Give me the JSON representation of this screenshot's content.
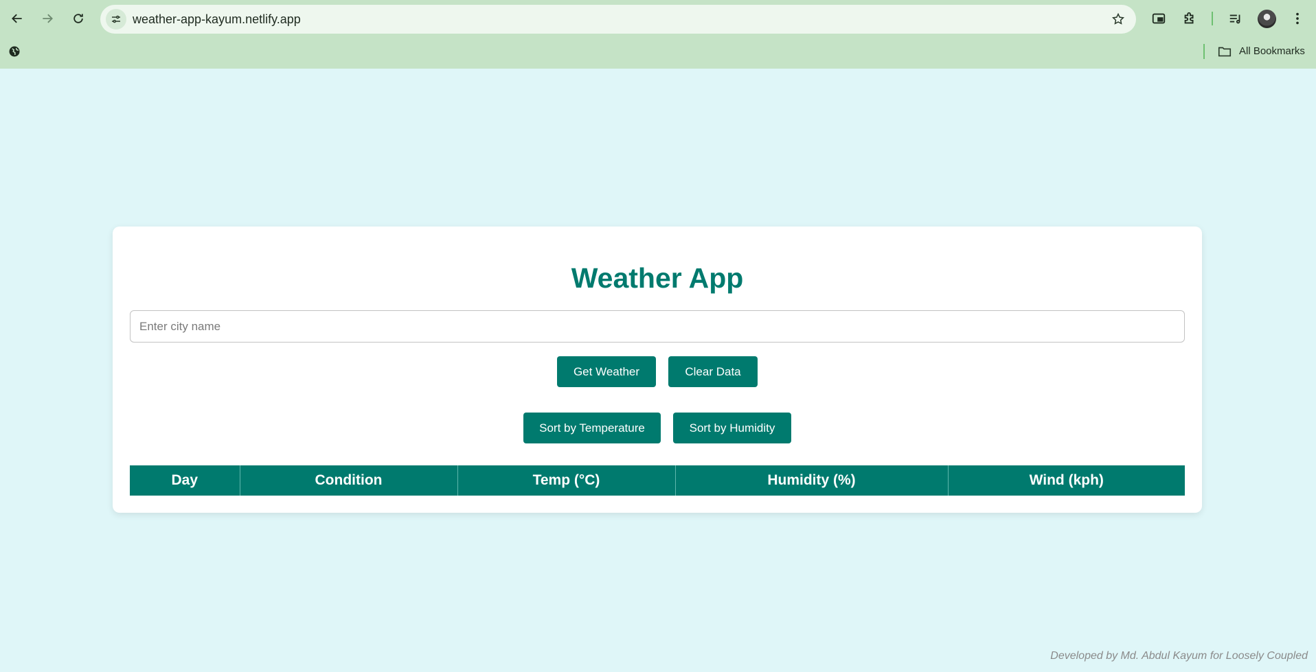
{
  "browser": {
    "url": "weather-app-kayum.netlify.app",
    "bookmarks_label": "All Bookmarks"
  },
  "icons": [
    "back-icon",
    "forward-icon",
    "reload-icon",
    "site-info-icon",
    "bookmark-star-icon",
    "picture-in-picture-icon",
    "extensions-icon",
    "media-queue-icon",
    "profile-avatar",
    "more-menu-icon",
    "globe-icon",
    "folder-icon"
  ],
  "app": {
    "title": "Weather App",
    "city_placeholder": "Enter city name",
    "city_value": "",
    "buttons": {
      "get_weather": "Get Weather",
      "clear_data": "Clear Data",
      "sort_temperature": "Sort by Temperature",
      "sort_humidity": "Sort by Humidity"
    },
    "table": {
      "headers": [
        "Day",
        "Condition",
        "Temp (°C)",
        "Humidity (%)",
        "Wind (kph)"
      ],
      "rows": []
    }
  },
  "footer": "Developed by Md. Abdul Kayum for Loosely Coupled",
  "colors": {
    "accent": "#007a6e",
    "page_background": "#dff6f8",
    "browser_chrome": "#c5e3c6"
  }
}
